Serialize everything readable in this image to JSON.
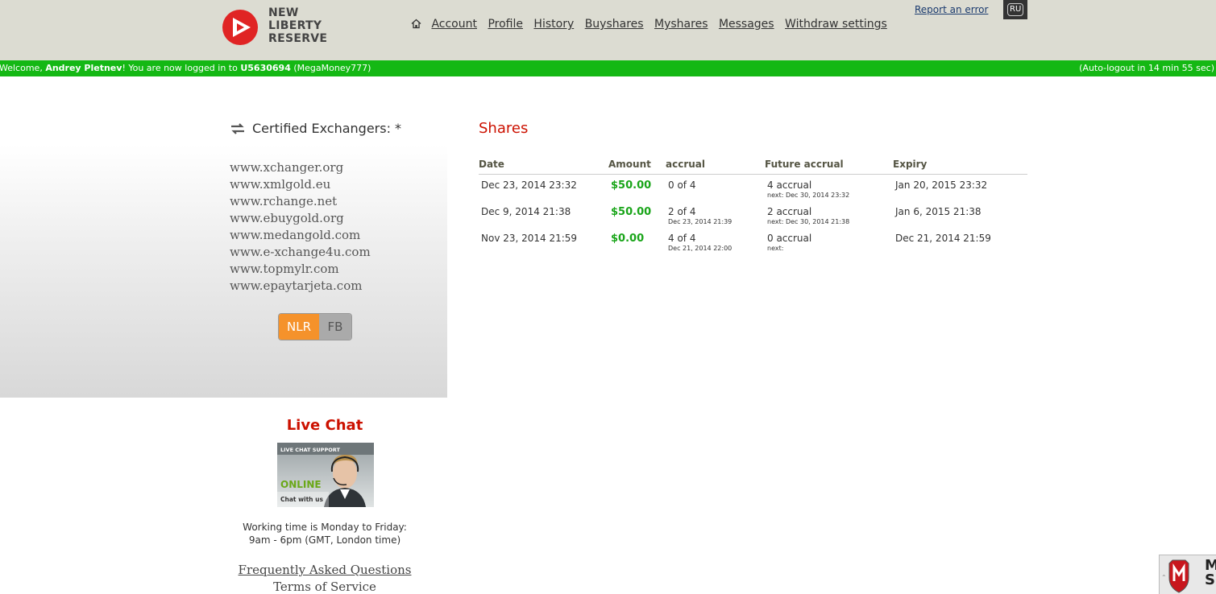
{
  "header": {
    "logo_lines": [
      "NEW",
      "LIBERTY",
      "RESERVE"
    ],
    "nav": [
      "Account",
      "Profile",
      "History",
      "Buyshares",
      "Myshares",
      "Messages",
      "Withdraw settings"
    ],
    "report_error": "Report an error",
    "lang": "RU"
  },
  "status": {
    "welcome_prefix": "Welcome, ",
    "user_name": "Andrey Pletnev",
    "logged_text": "! You are now logged in to ",
    "account_id": "U5630694",
    "account_alias": " (MegaMoney777)",
    "auto_logout": "(Auto-logout in 14 min 55 sec)"
  },
  "sidebar": {
    "certified_title": "Certified Exchangers: *",
    "exchangers": [
      "www.xchanger.org",
      "www.xmlgold.eu",
      "www.rchange.net",
      "www.ebuygold.org",
      "www.medangold.com",
      "www.e-xchange4u.com",
      "www.topmylr.com",
      "www.epaytarjeta.com"
    ],
    "toggle_nlr": "NLR",
    "toggle_fb": "FB",
    "live_chat_title": "Live Chat",
    "chat_banner_top": "LIVE CHAT SUPPORT",
    "chat_banner_online": "ONLINE",
    "chat_banner_bottom": "Chat with us",
    "working_time_line1": "Working time is Monday to Friday:",
    "working_time_line2": "9am - 6pm (GMT, London time)",
    "faq": "Frequently Asked Questions",
    "tos": "Terms of Service"
  },
  "shares": {
    "title": "Shares",
    "columns": [
      "Date",
      "Amount",
      "accrual",
      "Future accrual",
      "Expiry"
    ],
    "rows": [
      {
        "date": "Dec 23, 2014 23:32",
        "amount": "$50.00",
        "accrual": "0 of 4",
        "accrual_sub": "",
        "future": "4 accrual",
        "future_sub": "next: Dec 30, 2014 23:32",
        "expiry": "Jan 20, 2015 23:32"
      },
      {
        "date": "Dec 9, 2014 21:38",
        "amount": "$50.00",
        "accrual": "2 of 4",
        "accrual_sub": "Dec 23, 2014 21:39",
        "future": "2 accrual",
        "future_sub": "next: Dec 30, 2014 21:38",
        "expiry": "Jan 6, 2015 21:38"
      },
      {
        "date": "Nov 23, 2014 21:59",
        "amount": "$0.00",
        "accrual": "4 of 4",
        "accrual_sub": "Dec 21, 2014 22:00",
        "future": "0 accrual",
        "future_sub": "next:",
        "expiry": "Dec 21, 2014 21:59"
      }
    ]
  },
  "badge": {
    "letters": "M\nSE"
  }
}
